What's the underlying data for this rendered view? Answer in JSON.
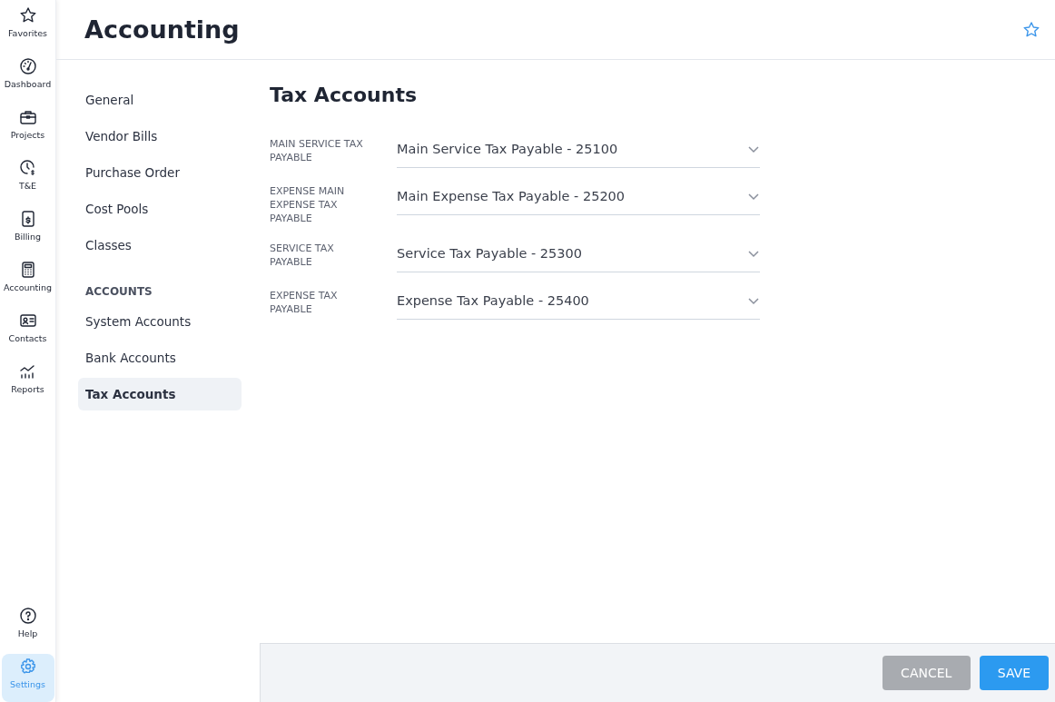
{
  "rail": {
    "items": [
      {
        "label": "Favorites",
        "selected": false
      },
      {
        "label": "Dashboard",
        "selected": false
      },
      {
        "label": "Projects",
        "selected": false
      },
      {
        "label": "T&E",
        "selected": false
      },
      {
        "label": "Billing",
        "selected": false
      },
      {
        "label": "Accounting",
        "selected": false
      },
      {
        "label": "Contacts",
        "selected": false
      },
      {
        "label": "Reports",
        "selected": false
      }
    ],
    "bottom_items": [
      {
        "label": "Help",
        "selected": false
      },
      {
        "label": "Settings",
        "selected": true
      }
    ]
  },
  "header": {
    "title": "Accounting",
    "favorite": false
  },
  "nav": {
    "groups": [
      {
        "items": [
          {
            "label": "General",
            "selected": false
          },
          {
            "label": "Vendor Bills",
            "selected": false
          },
          {
            "label": "Purchase Order",
            "selected": false
          },
          {
            "label": "Cost Pools",
            "selected": false
          },
          {
            "label": "Classes",
            "selected": false
          }
        ]
      },
      {
        "heading": "ACCOUNTS",
        "items": [
          {
            "label": "System Accounts",
            "selected": false
          },
          {
            "label": "Bank Accounts",
            "selected": false
          },
          {
            "label": "Tax Accounts",
            "selected": true
          }
        ]
      }
    ]
  },
  "form": {
    "title": "Tax Accounts",
    "fields": [
      {
        "label": "MAIN SERVICE TAX PAYABLE",
        "value": "Main Service Tax Payable - 25100"
      },
      {
        "label": "EXPENSE MAIN EXPENSE TAX PAYABLE",
        "value": "Main Expense Tax Payable - 25200"
      },
      {
        "label": "SERVICE TAX PAYABLE",
        "value": "Service Tax Payable - 25300"
      },
      {
        "label": "EXPENSE TAX PAYABLE",
        "value": "Expense Tax Payable - 25400"
      }
    ]
  },
  "footer": {
    "buttons": [
      {
        "label": "CANCEL",
        "kind": "secondary"
      },
      {
        "label": "SAVE",
        "kind": "primary"
      }
    ]
  }
}
